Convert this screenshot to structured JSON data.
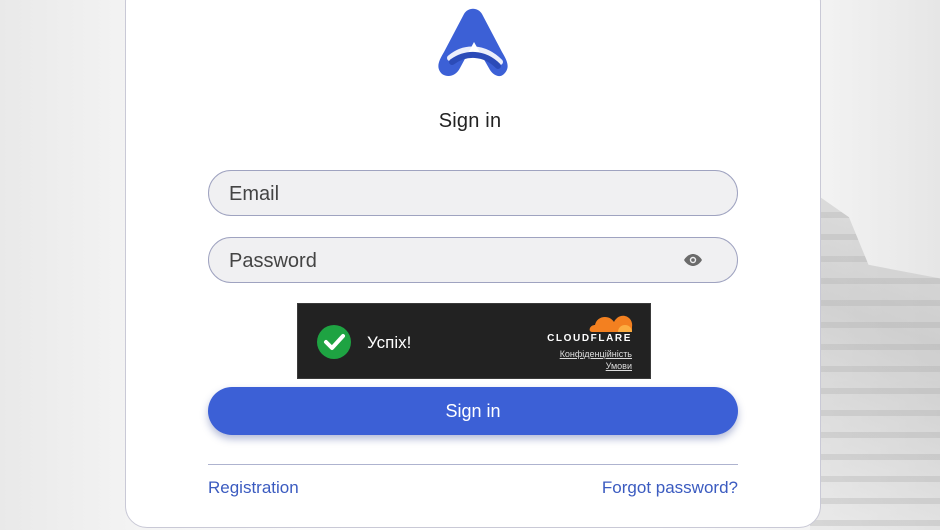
{
  "header": {
    "title": "Sign in"
  },
  "form": {
    "email_placeholder": "Email",
    "password_placeholder": "Password",
    "password_toggle_icon": "eye-icon",
    "submit_label": "Sign in"
  },
  "captcha": {
    "status": "Успіх!",
    "brand": "CLOUDFLARE",
    "privacy_link": "Конфіденційність",
    "terms_link": "Умови",
    "status_icon": "checkmark-icon",
    "brand_icon": "cloud-icon"
  },
  "footer": {
    "registration_link": "Registration",
    "forgot_link": "Forgot password?"
  },
  "colors": {
    "accent": "#3c60d6",
    "success": "#1ea342",
    "cloudflare_orange": "#f38020",
    "link": "#3b5bc0"
  }
}
